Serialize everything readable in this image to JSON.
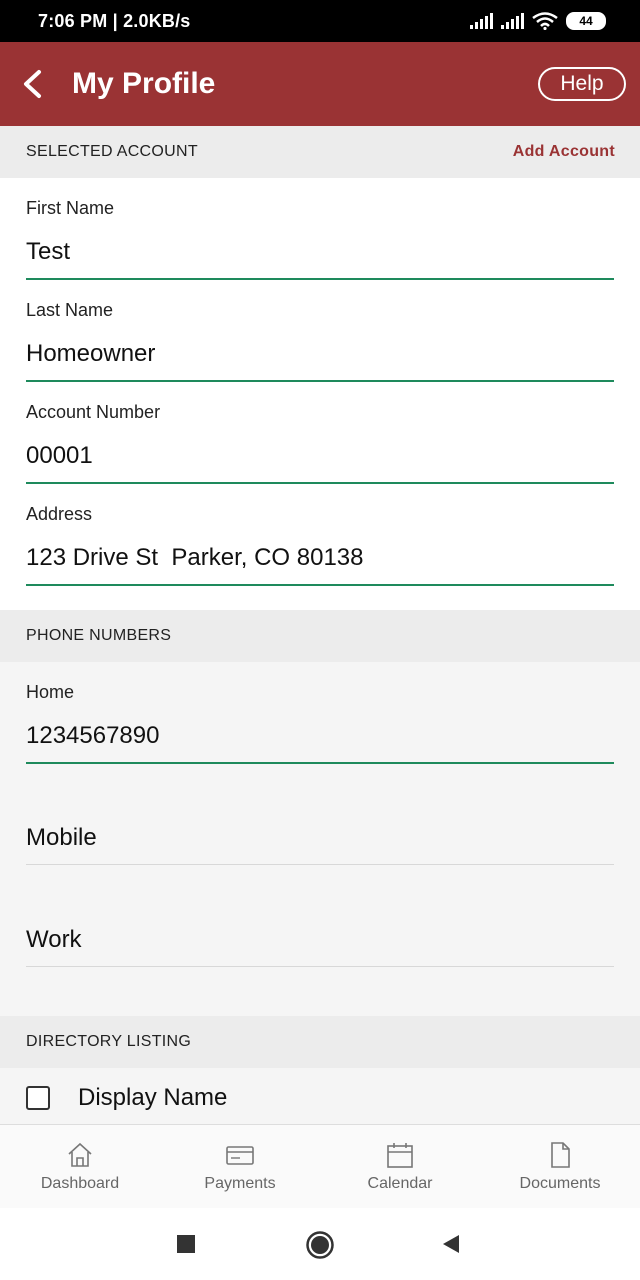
{
  "status_bar": {
    "time": "7:06 PM | 2.0KB/s",
    "battery": "44"
  },
  "header": {
    "title": "My Profile",
    "help_label": "Help"
  },
  "selected_account": {
    "section_title": "SELECTED ACCOUNT",
    "add_account_label": "Add Account",
    "fields": [
      {
        "label": "First Name",
        "value": "Test"
      },
      {
        "label": "Last Name",
        "value": "Homeowner"
      },
      {
        "label": "Account Number",
        "value": "00001"
      },
      {
        "label": "Address",
        "value": "123 Drive St  Parker, CO 80138"
      }
    ]
  },
  "phone_numbers": {
    "section_title": "PHONE NUMBERS",
    "home": {
      "label": "Home",
      "value": "1234567890"
    },
    "mobile_placeholder": "Mobile",
    "work_placeholder": "Work"
  },
  "directory_listing": {
    "section_title": "DIRECTORY LISTING",
    "display_name_label": "Display Name",
    "display_name_checked": false
  },
  "bottom_nav": [
    {
      "label": "Dashboard",
      "icon": "home-icon"
    },
    {
      "label": "Payments",
      "icon": "credit-card-icon"
    },
    {
      "label": "Calendar",
      "icon": "calendar-icon"
    },
    {
      "label": "Documents",
      "icon": "document-icon"
    }
  ],
  "colors": {
    "brand": "#9a3334",
    "underline_active": "#1e8a5c"
  }
}
